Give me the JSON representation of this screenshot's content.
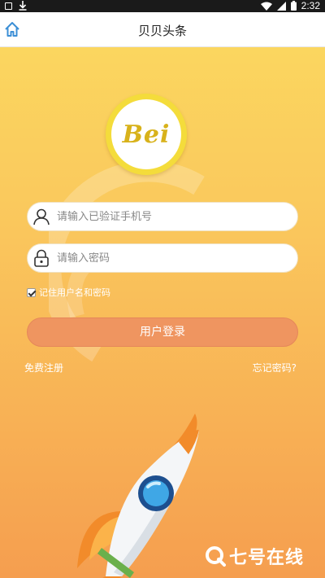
{
  "status_bar": {
    "time": "2:32"
  },
  "header": {
    "title": "贝贝头条"
  },
  "logo": {
    "text": "Bei"
  },
  "form": {
    "phone_placeholder": "请输入已验证手机号",
    "password_placeholder": "请输入密码",
    "remember_label": "记住用户名和密码",
    "remember_checked": true,
    "login_label": "用户登录",
    "register_label": "免费注册",
    "forgot_label": "忘记密码?"
  },
  "watermark": {
    "text": "七号在线"
  },
  "colors": {
    "accent": "#ef9560",
    "logo_gold": "#f4dc3b",
    "bg_top": "#fbd65f",
    "bg_bottom": "#f59e4f"
  }
}
